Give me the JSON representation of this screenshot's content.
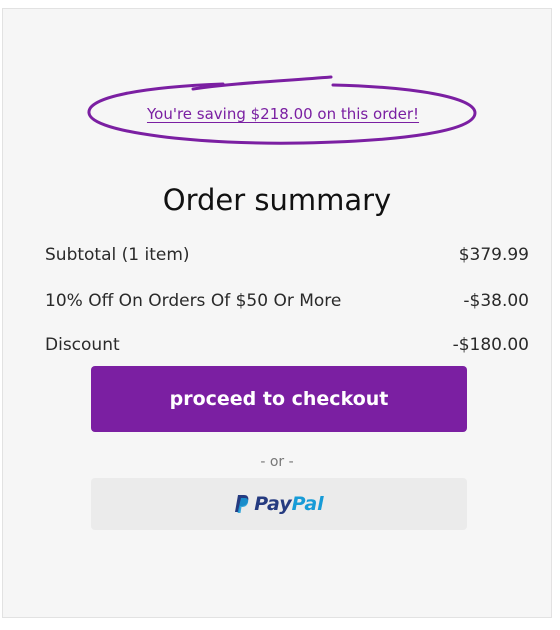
{
  "savings": {
    "text": "You're saving $218.00 on this order!"
  },
  "summary": {
    "title": "Order summary",
    "rows": [
      {
        "label": "Subtotal (1 item)",
        "value": "$379.99"
      },
      {
        "label": "10% Off On Orders Of $50 Or More",
        "value": "-$38.00"
      },
      {
        "label": "Discount",
        "value": "-$180.00"
      }
    ]
  },
  "actions": {
    "checkout_label": "proceed to checkout",
    "or_label": "- or -",
    "paypal": {
      "icon": "paypal-logo-icon",
      "text_pay": "Pay",
      "text_pal": "Pal"
    }
  },
  "colors": {
    "accent": "#7b1fa2",
    "paypal_dark": "#253b80",
    "paypal_light": "#179bd7"
  }
}
